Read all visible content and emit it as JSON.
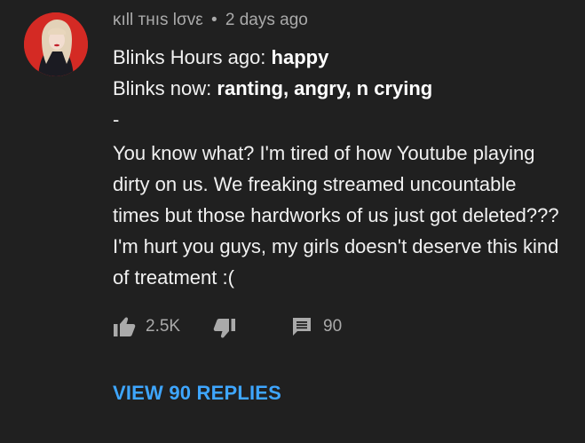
{
  "comment": {
    "author": "κıll тнıs lσvε",
    "separator": "•",
    "time": "2 days ago",
    "line1_prefix": "Blinks Hours ago: ",
    "line1_bold": "happy",
    "line2_prefix": "Blinks now: ",
    "line2_bold": "ranting, angry, n crying",
    "dash": "-",
    "body": "You know what? I'm tired of how Youtube playing dirty on us. We freaking streamed uncountable times but those hardworks of us just got deleted??? I'm hurt you guys, my girls doesn't deserve this kind of treatment :(",
    "likes": "2.5K",
    "reply_count": "90",
    "view_replies": "VIEW 90 REPLIES"
  },
  "icons": {
    "like": "thumbs-up-icon",
    "dislike": "thumbs-down-icon",
    "reply": "comment-icon"
  },
  "colors": {
    "background": "#202020",
    "meta_text": "#aaaaaa",
    "link": "#3ea6ff",
    "avatar_bg": "#d42a24"
  }
}
